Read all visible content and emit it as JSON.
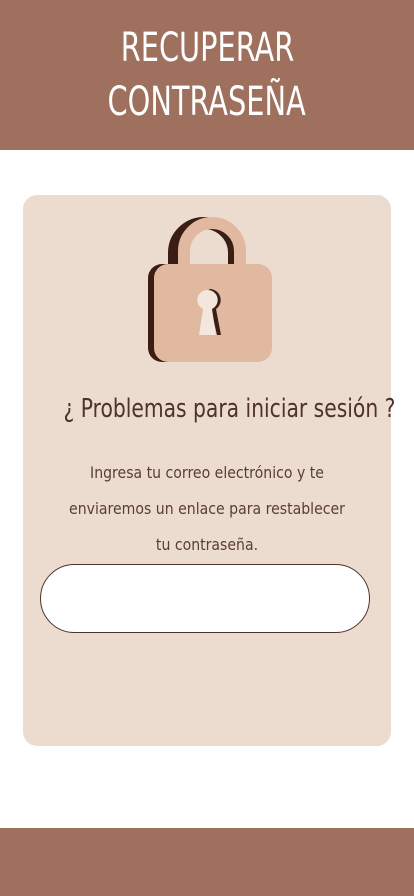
{
  "header": {
    "title_line1": "RECUPERAR",
    "title_line2": "CONTRASEÑA"
  },
  "card": {
    "icon": "lock-icon",
    "title": "¿ Problemas para iniciar sesión ?",
    "description": "Ingresa tu correo electrónico y te enviaremos un enlace para restablecer tu contraseña.",
    "email_input": {
      "value": "",
      "placeholder": ""
    }
  },
  "colors": {
    "header_bg": "#9f705d",
    "card_bg": "#ecdcd0",
    "lock_body": "#e1b9a0",
    "lock_shadow": "#3b1d14",
    "text": "#4e3327"
  }
}
